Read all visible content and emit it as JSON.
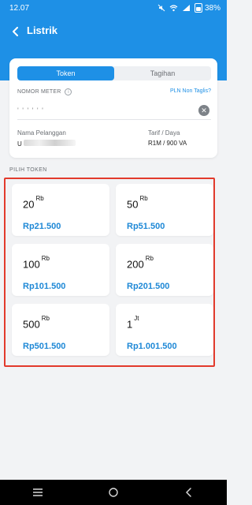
{
  "status": {
    "time": "12.07",
    "battery": "38%"
  },
  "appbar": {
    "title": "Listrik"
  },
  "tabs": [
    {
      "label": "Token",
      "active": true
    },
    {
      "label": "Tagihan",
      "active": false
    }
  ],
  "meter": {
    "label": "NOMOR METER",
    "link": "PLN Non Taglis?",
    "value": "' ' ' ' ' '",
    "clear_icon": "clear-icon"
  },
  "customer": {
    "name_label": "Nama Pelanggan",
    "name_value": "U",
    "tariff_label": "Tarif / Daya",
    "tariff_value": "R1M / 900 VA"
  },
  "section_label": "PILIH TOKEN",
  "tokens": [
    {
      "amount": "20",
      "unit": "Rb",
      "price": "Rp21.500"
    },
    {
      "amount": "50",
      "unit": "Rb",
      "price": "Rp51.500"
    },
    {
      "amount": "100",
      "unit": "Rb",
      "price": "Rp101.500"
    },
    {
      "amount": "200",
      "unit": "Rb",
      "price": "Rp201.500"
    },
    {
      "amount": "500",
      "unit": "Rb",
      "price": "Rp501.500"
    },
    {
      "amount": "1",
      "unit": "Jt",
      "price": "Rp1.001.500"
    }
  ],
  "colors": {
    "primary": "#1e90e6",
    "highlight_border": "#e23a2c",
    "price": "#1e88d6"
  }
}
